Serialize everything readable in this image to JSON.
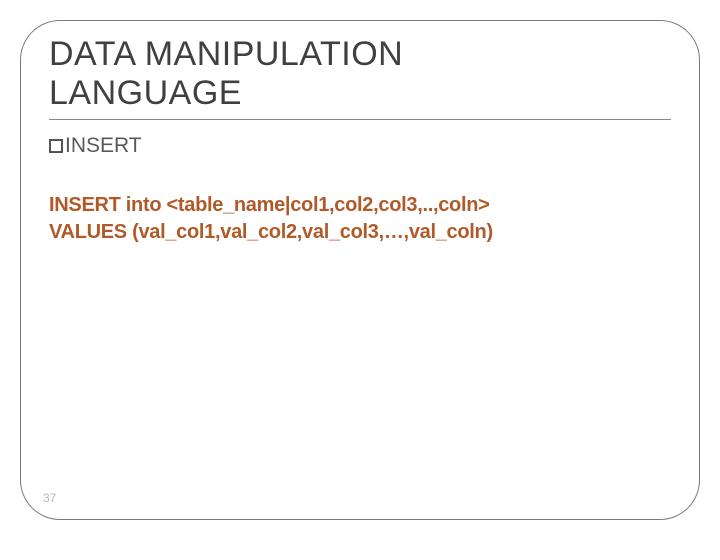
{
  "slide": {
    "title": "DATA MANIPULATION LANGUAGE",
    "bullet1": "INSERT",
    "code_line1": "INSERT into <table_name|col1,col2,col3,..,coln>",
    "code_line2": "VALUES (val_col1,val_col2,val_col3,…,val_coln)",
    "number": "37"
  }
}
